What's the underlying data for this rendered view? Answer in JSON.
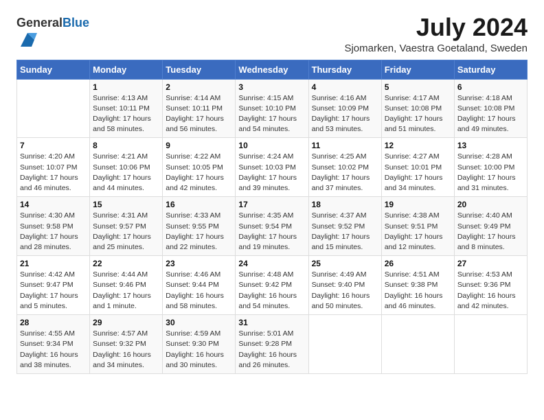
{
  "header": {
    "logo_general": "General",
    "logo_blue": "Blue",
    "month_year": "July 2024",
    "location": "Sjomarken, Vaestra Goetaland, Sweden"
  },
  "columns": [
    "Sunday",
    "Monday",
    "Tuesday",
    "Wednesday",
    "Thursday",
    "Friday",
    "Saturday"
  ],
  "weeks": [
    [
      {
        "day": "",
        "info": ""
      },
      {
        "day": "1",
        "info": "Sunrise: 4:13 AM\nSunset: 10:11 PM\nDaylight: 17 hours\nand 58 minutes."
      },
      {
        "day": "2",
        "info": "Sunrise: 4:14 AM\nSunset: 10:11 PM\nDaylight: 17 hours\nand 56 minutes."
      },
      {
        "day": "3",
        "info": "Sunrise: 4:15 AM\nSunset: 10:10 PM\nDaylight: 17 hours\nand 54 minutes."
      },
      {
        "day": "4",
        "info": "Sunrise: 4:16 AM\nSunset: 10:09 PM\nDaylight: 17 hours\nand 53 minutes."
      },
      {
        "day": "5",
        "info": "Sunrise: 4:17 AM\nSunset: 10:08 PM\nDaylight: 17 hours\nand 51 minutes."
      },
      {
        "day": "6",
        "info": "Sunrise: 4:18 AM\nSunset: 10:08 PM\nDaylight: 17 hours\nand 49 minutes."
      }
    ],
    [
      {
        "day": "7",
        "info": "Sunrise: 4:20 AM\nSunset: 10:07 PM\nDaylight: 17 hours\nand 46 minutes."
      },
      {
        "day": "8",
        "info": "Sunrise: 4:21 AM\nSunset: 10:06 PM\nDaylight: 17 hours\nand 44 minutes."
      },
      {
        "day": "9",
        "info": "Sunrise: 4:22 AM\nSunset: 10:05 PM\nDaylight: 17 hours\nand 42 minutes."
      },
      {
        "day": "10",
        "info": "Sunrise: 4:24 AM\nSunset: 10:03 PM\nDaylight: 17 hours\nand 39 minutes."
      },
      {
        "day": "11",
        "info": "Sunrise: 4:25 AM\nSunset: 10:02 PM\nDaylight: 17 hours\nand 37 minutes."
      },
      {
        "day": "12",
        "info": "Sunrise: 4:27 AM\nSunset: 10:01 PM\nDaylight: 17 hours\nand 34 minutes."
      },
      {
        "day": "13",
        "info": "Sunrise: 4:28 AM\nSunset: 10:00 PM\nDaylight: 17 hours\nand 31 minutes."
      }
    ],
    [
      {
        "day": "14",
        "info": "Sunrise: 4:30 AM\nSunset: 9:58 PM\nDaylight: 17 hours\nand 28 minutes."
      },
      {
        "day": "15",
        "info": "Sunrise: 4:31 AM\nSunset: 9:57 PM\nDaylight: 17 hours\nand 25 minutes."
      },
      {
        "day": "16",
        "info": "Sunrise: 4:33 AM\nSunset: 9:55 PM\nDaylight: 17 hours\nand 22 minutes."
      },
      {
        "day": "17",
        "info": "Sunrise: 4:35 AM\nSunset: 9:54 PM\nDaylight: 17 hours\nand 19 minutes."
      },
      {
        "day": "18",
        "info": "Sunrise: 4:37 AM\nSunset: 9:52 PM\nDaylight: 17 hours\nand 15 minutes."
      },
      {
        "day": "19",
        "info": "Sunrise: 4:38 AM\nSunset: 9:51 PM\nDaylight: 17 hours\nand 12 minutes."
      },
      {
        "day": "20",
        "info": "Sunrise: 4:40 AM\nSunset: 9:49 PM\nDaylight: 17 hours\nand 8 minutes."
      }
    ],
    [
      {
        "day": "21",
        "info": "Sunrise: 4:42 AM\nSunset: 9:47 PM\nDaylight: 17 hours\nand 5 minutes."
      },
      {
        "day": "22",
        "info": "Sunrise: 4:44 AM\nSunset: 9:46 PM\nDaylight: 17 hours\nand 1 minute."
      },
      {
        "day": "23",
        "info": "Sunrise: 4:46 AM\nSunset: 9:44 PM\nDaylight: 16 hours\nand 58 minutes."
      },
      {
        "day": "24",
        "info": "Sunrise: 4:48 AM\nSunset: 9:42 PM\nDaylight: 16 hours\nand 54 minutes."
      },
      {
        "day": "25",
        "info": "Sunrise: 4:49 AM\nSunset: 9:40 PM\nDaylight: 16 hours\nand 50 minutes."
      },
      {
        "day": "26",
        "info": "Sunrise: 4:51 AM\nSunset: 9:38 PM\nDaylight: 16 hours\nand 46 minutes."
      },
      {
        "day": "27",
        "info": "Sunrise: 4:53 AM\nSunset: 9:36 PM\nDaylight: 16 hours\nand 42 minutes."
      }
    ],
    [
      {
        "day": "28",
        "info": "Sunrise: 4:55 AM\nSunset: 9:34 PM\nDaylight: 16 hours\nand 38 minutes."
      },
      {
        "day": "29",
        "info": "Sunrise: 4:57 AM\nSunset: 9:32 PM\nDaylight: 16 hours\nand 34 minutes."
      },
      {
        "day": "30",
        "info": "Sunrise: 4:59 AM\nSunset: 9:30 PM\nDaylight: 16 hours\nand 30 minutes."
      },
      {
        "day": "31",
        "info": "Sunrise: 5:01 AM\nSunset: 9:28 PM\nDaylight: 16 hours\nand 26 minutes."
      },
      {
        "day": "",
        "info": ""
      },
      {
        "day": "",
        "info": ""
      },
      {
        "day": "",
        "info": ""
      }
    ]
  ]
}
